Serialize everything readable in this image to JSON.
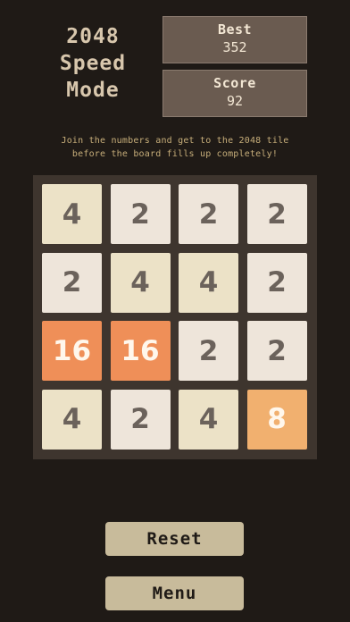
{
  "header": {
    "title_lines": [
      "2048",
      "Speed",
      "Mode"
    ]
  },
  "stats": {
    "best_label": "Best",
    "best_value": "352",
    "score_label": "Score",
    "score_value": "92"
  },
  "instructions": {
    "line1": "Join the numbers and get to the 2048 tile",
    "line2": "before the board fills up completely!"
  },
  "board": {
    "rows": [
      [
        "4",
        "2",
        "2",
        "2"
      ],
      [
        "2",
        "4",
        "4",
        "2"
      ],
      [
        "16",
        "16",
        "2",
        "2"
      ],
      [
        "4",
        "2",
        "4",
        "8"
      ]
    ],
    "tile_colors": {
      "2": "#eee5da",
      "4": "#ece2c7",
      "8": "#f1b06f",
      "16": "#ef8f58"
    }
  },
  "buttons": {
    "reset_label": "Reset",
    "menu_label": "Menu"
  }
}
